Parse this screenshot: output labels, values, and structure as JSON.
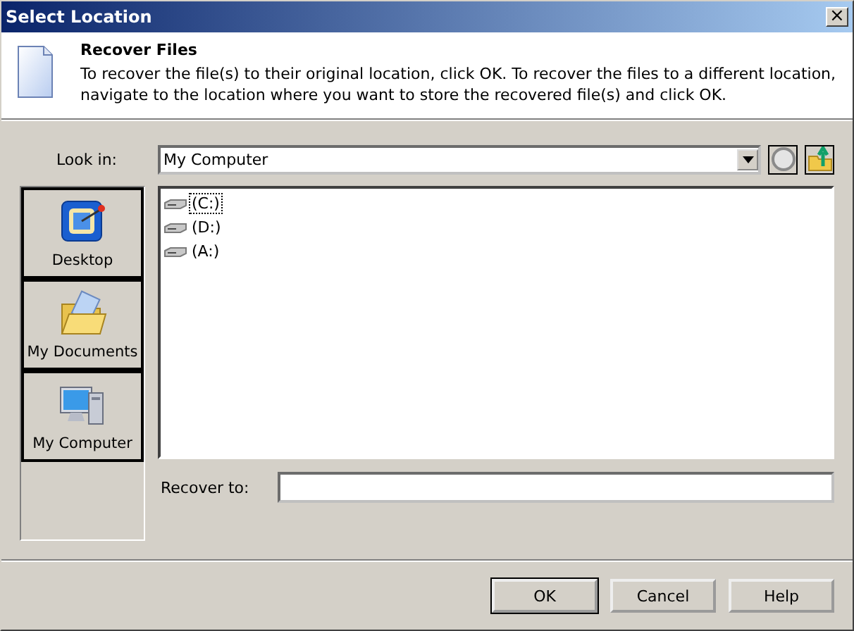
{
  "window": {
    "title": "Select Location",
    "close": "×"
  },
  "header": {
    "title": "Recover Files",
    "text": "To recover the file(s) to their original location, click OK. To recover the files to a different location, navigate to the location where you want to store the recovered file(s) and click OK."
  },
  "look_in": {
    "label": "Look in:",
    "value": "My Computer"
  },
  "places": [
    {
      "label": "Desktop",
      "kind": "desktop"
    },
    {
      "label": "My Documents",
      "kind": "documents"
    },
    {
      "label": "My Computer",
      "kind": "computer"
    }
  ],
  "files": [
    {
      "name": "(C:)",
      "selected": true
    },
    {
      "name": "(D:)",
      "selected": false
    },
    {
      "name": "(A:)",
      "selected": false
    }
  ],
  "recover_to": {
    "label": "Recover to:"
  },
  "buttons": [
    {
      "label": "OK",
      "default": true
    },
    {
      "label": "Cancel",
      "default": false
    },
    {
      "label": "Help",
      "default": false
    }
  ]
}
